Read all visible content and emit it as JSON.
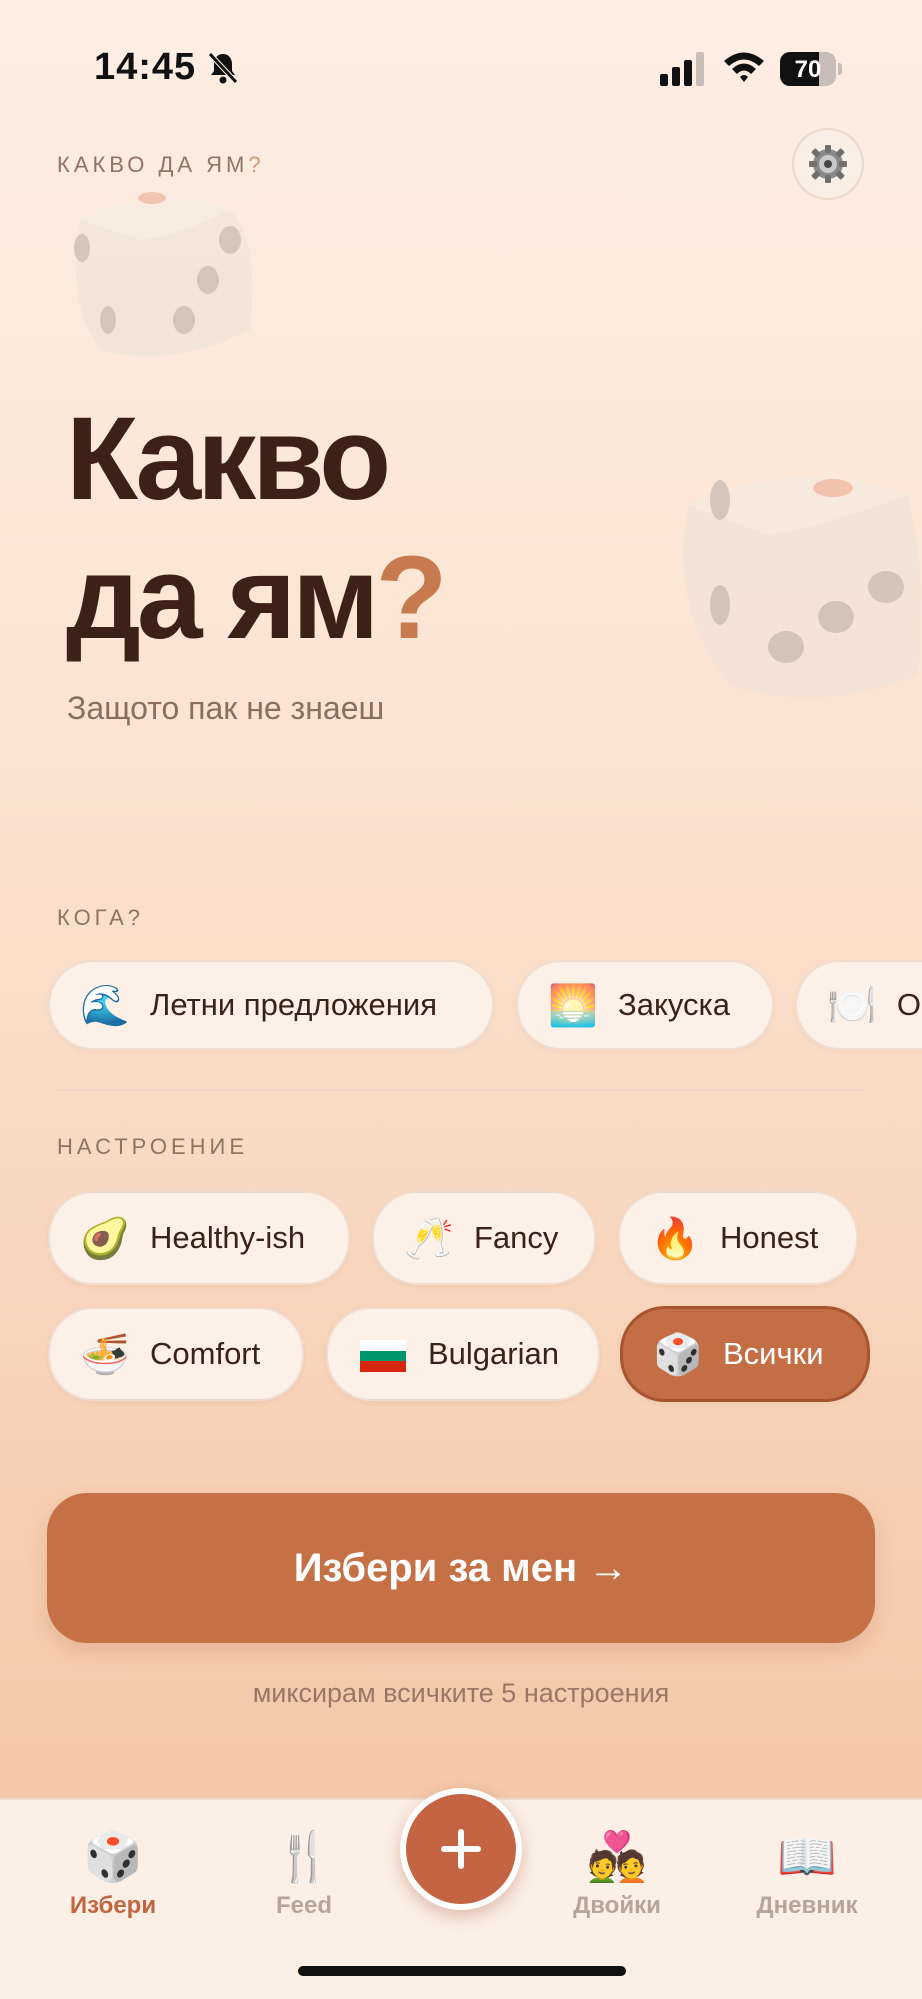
{
  "status_bar": {
    "time": "14:45",
    "battery": "70",
    "battery_level": 0.7
  },
  "header": {
    "eyebrow_text": "КАКВО ДА ЯМ",
    "eyebrow_q": "?",
    "settings_icon": "gear-icon"
  },
  "hero": {
    "title_line1": "Какво",
    "title_line2": "да ям",
    "title_mark": "?",
    "subtitle": "Защото пак не знаеш"
  },
  "when": {
    "label": "КОГА?",
    "chips": [
      {
        "emoji": "🌊",
        "label": "Летни предложения"
      },
      {
        "emoji": "🌅",
        "label": "Закуска"
      },
      {
        "emoji": "🍽️",
        "label": "Обяд"
      }
    ]
  },
  "mood": {
    "label": "НАСТРОЕНИЕ",
    "chips": [
      {
        "emoji": "🥑",
        "label": "Healthy-ish"
      },
      {
        "emoji": "🥂",
        "label": "Fancy"
      },
      {
        "emoji": "🔥",
        "label": "Honest"
      },
      {
        "emoji": "🍜",
        "label": "Comfort"
      },
      {
        "emoji": "🇧🇬",
        "label": "Bulgarian"
      },
      {
        "emoji": "🎲",
        "label": "Всички",
        "selected": true
      }
    ]
  },
  "cta": {
    "label": "Избери за мен →"
  },
  "mix_note": "миксирам всичките 5 настроения",
  "tabbar": {
    "tabs": [
      {
        "icon": "🎲",
        "label": "Избери",
        "active": true
      },
      {
        "icon": "🍴",
        "label": "Feed"
      },
      {
        "icon": "💑",
        "label": "Двойки"
      },
      {
        "icon": "📖",
        "label": "Дневник"
      }
    ],
    "fab_icon": "plus-icon"
  },
  "colors": {
    "accent": "#c46e45",
    "title": "#3d2017",
    "background": "#fbe3d1"
  }
}
